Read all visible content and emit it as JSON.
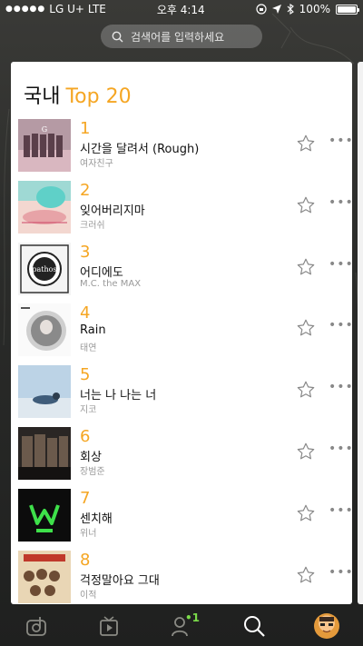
{
  "status": {
    "carrier": "LG U+",
    "network": "LTE",
    "time": "오후 4:14",
    "battery": "100%",
    "battery_level": 1.0
  },
  "search": {
    "placeholder": "검색어를 입력하세요"
  },
  "chart": {
    "title_prefix": "국내",
    "title_highlight": "Top 20",
    "items": [
      {
        "rank": "1",
        "song": "시간을 달려서 (Rough)",
        "artist": "여자친구"
      },
      {
        "rank": "2",
        "song": "잊어버리지마",
        "artist": "크러쉬"
      },
      {
        "rank": "3",
        "song": "어디에도",
        "artist": "M.C. the MAX"
      },
      {
        "rank": "4",
        "song": "Rain",
        "artist": "태연"
      },
      {
        "rank": "5",
        "song": "너는 나 나는 너",
        "artist": "지코"
      },
      {
        "rank": "6",
        "song": "회상",
        "artist": "장범준"
      },
      {
        "rank": "7",
        "song": "센치해",
        "artist": "위너"
      },
      {
        "rank": "8",
        "song": "걱정말아요 그대",
        "artist": "이적"
      }
    ],
    "more_glyph": "•••"
  },
  "tabs": {
    "friends_badge": "1"
  },
  "colors": {
    "accent": "#f5a623",
    "badge": "#7bdc4a"
  }
}
